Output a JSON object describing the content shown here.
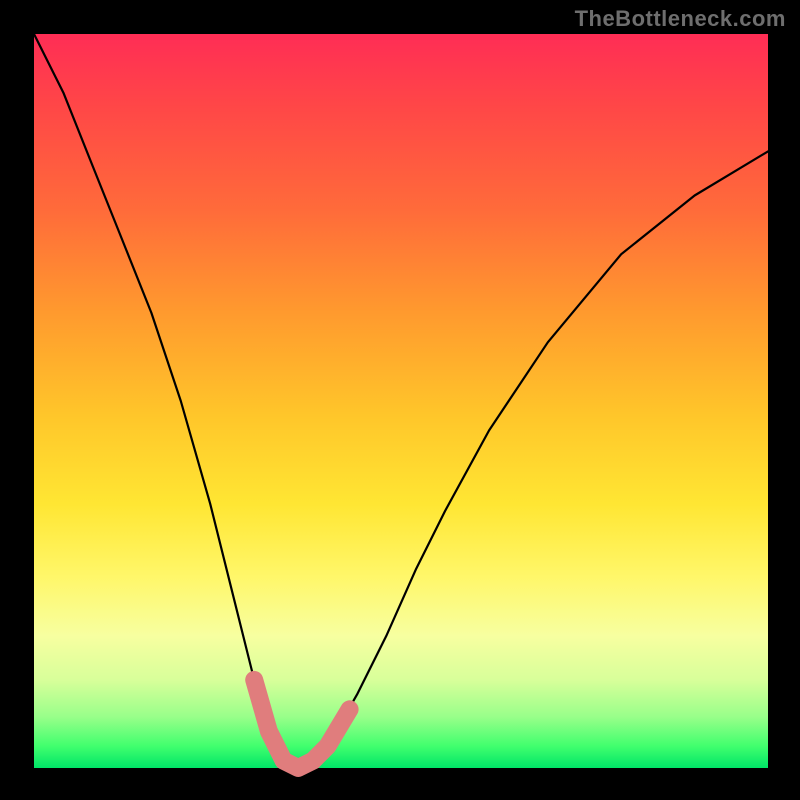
{
  "watermark": "TheBottleneck.com",
  "chart_data": {
    "type": "line",
    "title": "",
    "xlabel": "",
    "ylabel": "",
    "xlim": [
      0,
      100
    ],
    "ylim": [
      0,
      100
    ],
    "grid": false,
    "background_gradient": [
      "#ff2d55",
      "#ffe633",
      "#00e567"
    ],
    "series": [
      {
        "name": "bottleneck-curve",
        "x": [
          0,
          4,
          8,
          12,
          16,
          20,
          24,
          27,
          30,
          32,
          34,
          36,
          38,
          40,
          44,
          48,
          52,
          56,
          62,
          70,
          80,
          90,
          100
        ],
        "values": [
          100,
          92,
          82,
          72,
          62,
          50,
          36,
          24,
          12,
          5,
          1,
          0,
          1,
          3,
          10,
          18,
          27,
          35,
          46,
          58,
          70,
          78,
          84
        ]
      }
    ],
    "highlight_region": {
      "name": "optimal-zone",
      "points": [
        {
          "x": 30,
          "y": 12
        },
        {
          "x": 32,
          "y": 5
        },
        {
          "x": 34,
          "y": 1
        },
        {
          "x": 36,
          "y": 0
        },
        {
          "x": 38,
          "y": 1
        },
        {
          "x": 40,
          "y": 3
        },
        {
          "x": 43,
          "y": 8
        }
      ]
    }
  }
}
